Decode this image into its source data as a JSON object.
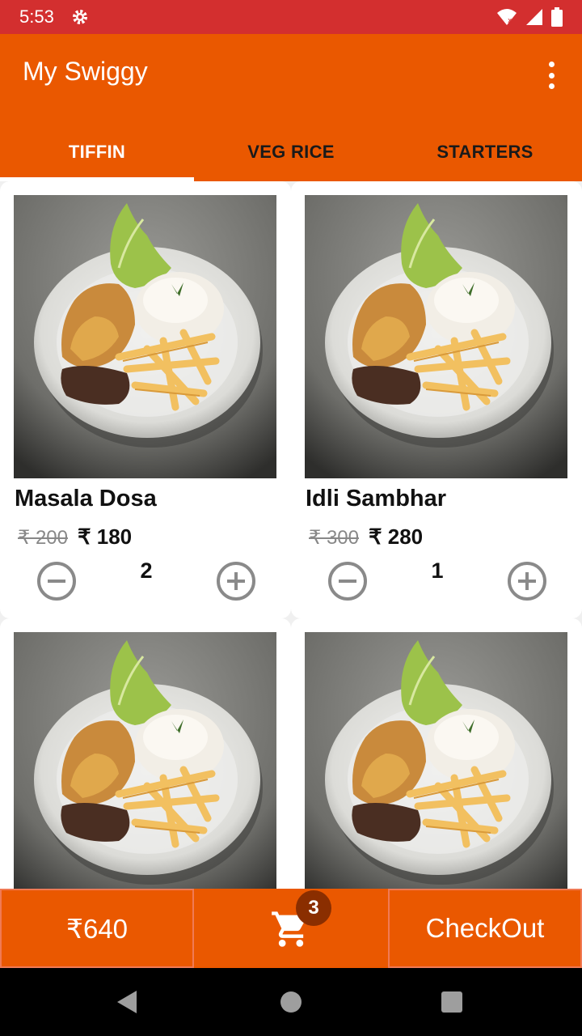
{
  "status_bar": {
    "time": "5:53"
  },
  "app": {
    "title": "My Swiggy"
  },
  "tabs": [
    {
      "label": "TIFFIN",
      "active": true
    },
    {
      "label": "VEG RICE",
      "active": false
    },
    {
      "label": "STARTERS",
      "active": false
    }
  ],
  "items": [
    {
      "name": "Masala Dosa",
      "old_price": "₹ 200",
      "price": "₹ 180",
      "qty": "2"
    },
    {
      "name": "Idli Sambhar",
      "old_price": "₹ 300",
      "price": "₹ 280",
      "qty": "1"
    },
    {
      "name": "",
      "old_price": "",
      "price": "",
      "qty": ""
    },
    {
      "name": "",
      "old_price": "",
      "price": "",
      "qty": ""
    }
  ],
  "bottom_bar": {
    "total": "₹640",
    "cart_count": "3",
    "checkout_label": "CheckOut"
  },
  "colors": {
    "status_bar": "#d32f2f",
    "accent": "#ea5800",
    "badge": "#8a2e00"
  }
}
